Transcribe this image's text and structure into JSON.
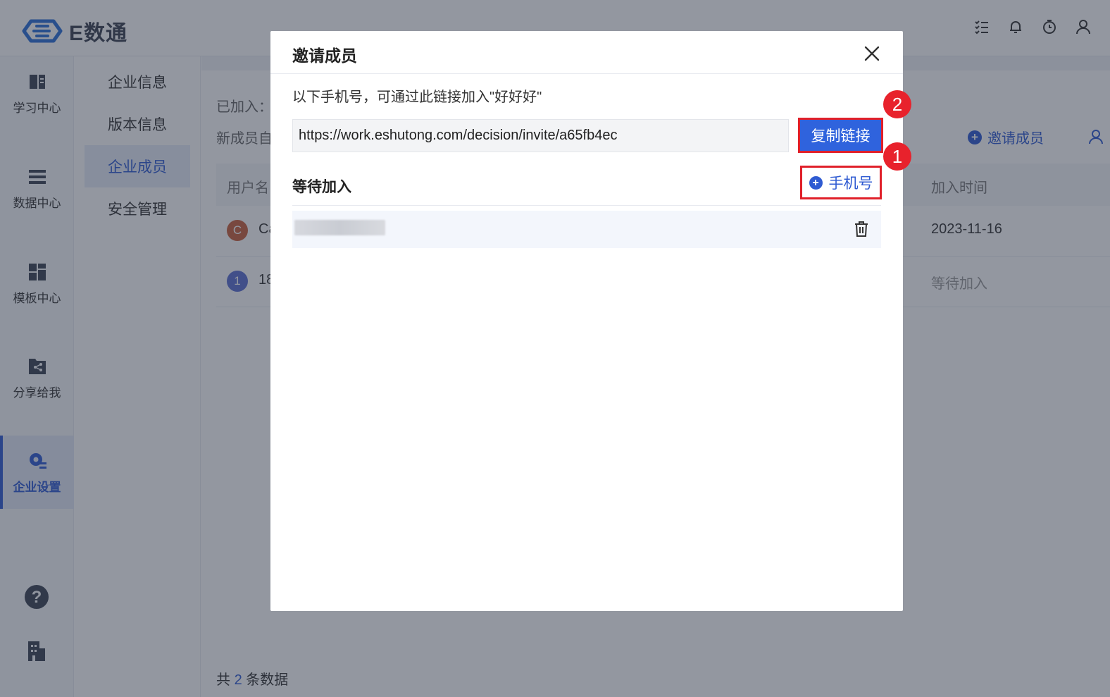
{
  "app": {
    "logo_text": "E数通"
  },
  "topbar_icons": [
    "task-list-icon",
    "bell-icon",
    "timer-icon",
    "user-icon"
  ],
  "leftnav": {
    "items": [
      {
        "label": "学习中心",
        "icon": "book-icon"
      },
      {
        "label": "数据中心",
        "icon": "data-icon"
      },
      {
        "label": "模板中心",
        "icon": "template-icon"
      },
      {
        "label": "分享给我",
        "icon": "share-icon"
      },
      {
        "label": "企业设置",
        "icon": "settings-icon",
        "active": true
      }
    ],
    "bottom_icons": [
      "help-icon",
      "building-icon"
    ]
  },
  "subnav": {
    "items": [
      {
        "label": "企业信息"
      },
      {
        "label": "版本信息"
      },
      {
        "label": "企业成员",
        "active": true
      },
      {
        "label": "安全管理"
      }
    ]
  },
  "main": {
    "joined_label": "已加入：",
    "new_member_label": "新成员自",
    "invite_label": "邀请成员",
    "table": {
      "headers": {
        "username": "用户名",
        "join_time": "加入时间"
      },
      "rows": [
        {
          "avatar": "C",
          "name": "Ca",
          "join_time": "2023-11-16",
          "avatar_color": "#c8603c"
        },
        {
          "avatar": "1",
          "name": "18",
          "join_time": "等待加入",
          "avatar_color": "#5a6fd1"
        }
      ]
    },
    "footer": {
      "prefix": "共",
      "count": "2",
      "suffix": "条数据"
    }
  },
  "modal": {
    "title": "邀请成员",
    "description": "以下手机号，可通过此链接加入\"好好好\"",
    "invite_url": "https://work.eshutong.com/decision/invite/a65fb4ec",
    "copy_button": "复制链接",
    "pending_title": "等待加入",
    "add_phone_button": "手机号",
    "pending_rows": [
      {
        "phone": ""
      }
    ]
  },
  "annotations": {
    "badge_1": "1",
    "badge_2": "2",
    "highlight_color": "#e0202a"
  },
  "colors": {
    "primary": "#2f5bd2",
    "button": "#2f63dd",
    "badge": "#e8222c"
  }
}
